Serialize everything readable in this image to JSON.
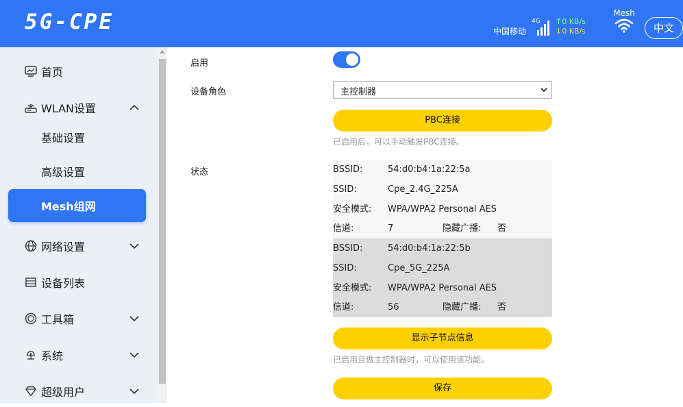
{
  "header": {
    "logo": "5G-CPE",
    "carrier": "中国移动",
    "network_type": "4G",
    "upload_rate": "↑0 KB/s",
    "download_rate": "↓0 KB/s",
    "mesh_label": "Mesh",
    "language_button": "中文"
  },
  "sidebar": {
    "home": "首页",
    "wlan": "WLAN设置",
    "wlan_basic": "基础设置",
    "wlan_advanced": "高级设置",
    "mesh": "Mesh组网",
    "network": "网络设置",
    "devices": "设备列表",
    "toolbox": "工具箱",
    "system": "系统",
    "superuser": "超级用户"
  },
  "form": {
    "enable_label": "启用",
    "enabled": true,
    "role_label": "设备角色",
    "role_value": "主控制器",
    "pbc_button": "PBC连接",
    "pbc_hint": "已启用后，可以手动触发PBC连接。",
    "status_label": "状态",
    "networks": [
      {
        "bssid_label": "BSSID:",
        "bssid": "54:d0:b4:1a:22:5a",
        "ssid_label": "SSID:",
        "ssid": "Cpe_2.4G_225A",
        "security_label": "安全模式:",
        "security": "WPA/WPA2 Personal AES",
        "channel_label": "信道:",
        "channel": "7",
        "hidden_label": "隐藏广播:",
        "hidden": "否"
      },
      {
        "bssid_label": "BSSID:",
        "bssid": "54:d0:b4:1a:22:5b",
        "ssid_label": "SSID:",
        "ssid": "Cpe_5G_225A",
        "security_label": "安全模式:",
        "security": "WPA/WPA2 Personal AES",
        "channel_label": "信道:",
        "channel": "56",
        "hidden_label": "隐藏广播:",
        "hidden": "否"
      }
    ],
    "subnode_button": "显示子节点信息",
    "subnode_hint": "已启用且做主控制器时，可以使用该功能。",
    "save_button": "保存"
  },
  "colors": {
    "primary": "#2f75f4",
    "button_yellow": "#fdd000",
    "sidebar_bg": "#ebf0f7",
    "status_bg_1": "#f7f7f7",
    "status_bg_2": "#dcdcdc"
  }
}
